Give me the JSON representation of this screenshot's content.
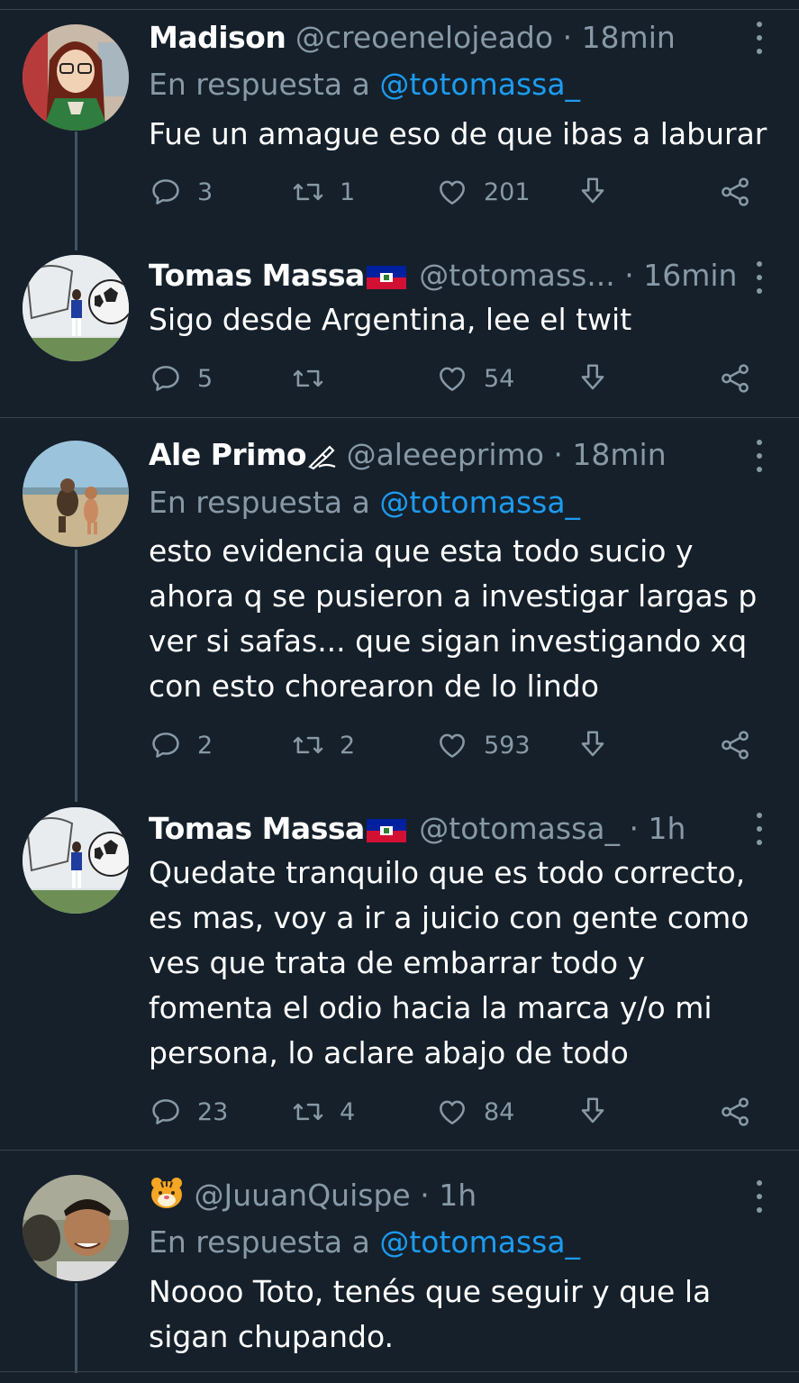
{
  "tweets": [
    {
      "name": "Madison",
      "handle": "@creoenelojeado",
      "separator": "·",
      "time": "18min",
      "reply_prefix": "En respuesta a",
      "reply_mention": "@totomassa_",
      "text": "Fue un amague eso de que ibas a laburar",
      "replies": "3",
      "retweets": "1",
      "likes": "201"
    },
    {
      "name": "Tomas Massa",
      "handle": "@totomass...",
      "separator": "·",
      "time": "16min",
      "text": "Sigo desde Argentina, lee el twit",
      "replies": "5",
      "retweets": "",
      "likes": "54"
    },
    {
      "name": "Ale Primo",
      "handle": "@aleeeprimo",
      "separator": "·",
      "time": "18min",
      "reply_prefix": "En respuesta a",
      "reply_mention": "@totomassa_",
      "text": "esto evidencia que esta todo sucio y\nahora q se pusieron a investigar largas p\nver si safas... que sigan investigando xq\ncon esto chorearon de lo lindo",
      "replies": "2",
      "retweets": "2",
      "likes": "593"
    },
    {
      "name": "Tomas Massa",
      "handle": "@totomassa_",
      "separator": "·",
      "time": "1h",
      "text": "Quedate tranquilo que es todo correcto,\nes mas, voy a ir a juicio con gente como\nves que trata de embarrar todo y\nfomenta el odio hacia la marca y/o mi\npersona, lo aclare abajo de todo",
      "replies": "23",
      "retweets": "4",
      "likes": "84"
    },
    {
      "name": "",
      "handle": "@JuuanQuispe",
      "separator": "·",
      "time": "1h",
      "reply_prefix": "En respuesta a",
      "reply_mention": "@totomassa_",
      "text": "Noooo Toto, tenés que seguir y que la\nsigan chupando."
    }
  ],
  "icons": {
    "reply": "comment-icon",
    "retweet": "retweet-icon",
    "like": "heart-icon",
    "download": "download-icon",
    "share": "share-icon",
    "more": "more-vertical-icon",
    "flag": "haiti-flag-icon",
    "writing_hand": "writing-hand-emoji",
    "tiger": "tiger-face-emoji"
  },
  "colors": {
    "background": "#15202b",
    "secondary_text": "#8899a6",
    "mention": "#1d9bf0",
    "divider": "#38444d"
  }
}
